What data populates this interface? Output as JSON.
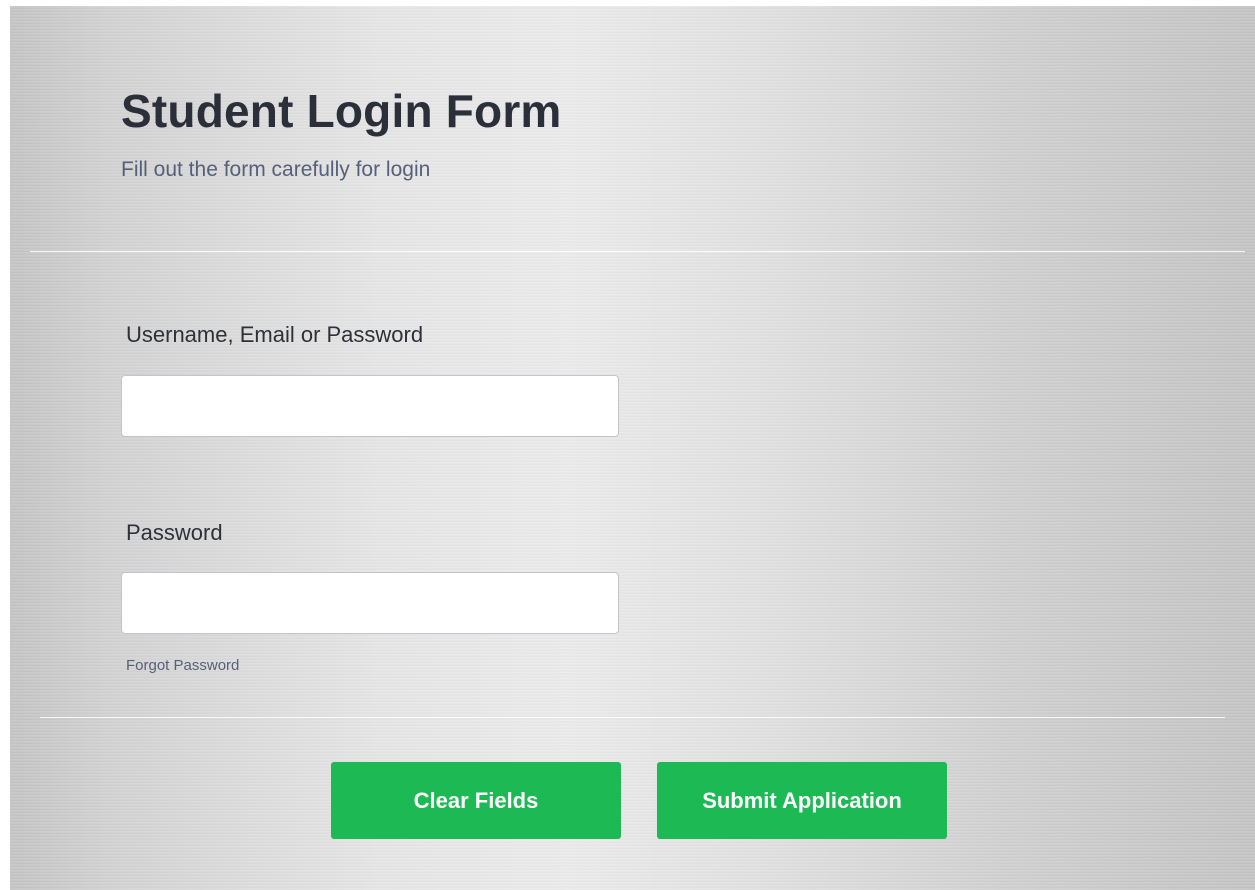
{
  "form": {
    "title": "Student Login Form",
    "subtitle": "Fill out the form carefully for login",
    "username_label": "Username, Email or Password",
    "username_value": "",
    "password_label": "Password",
    "password_value": "",
    "forgot_link": "Forgot Password",
    "clear_button": "Clear Fields",
    "submit_button": "Submit Application"
  },
  "colors": {
    "accent_green": "#1db954",
    "title_color": "#2b2f3a",
    "subtitle_color": "#57607a"
  }
}
